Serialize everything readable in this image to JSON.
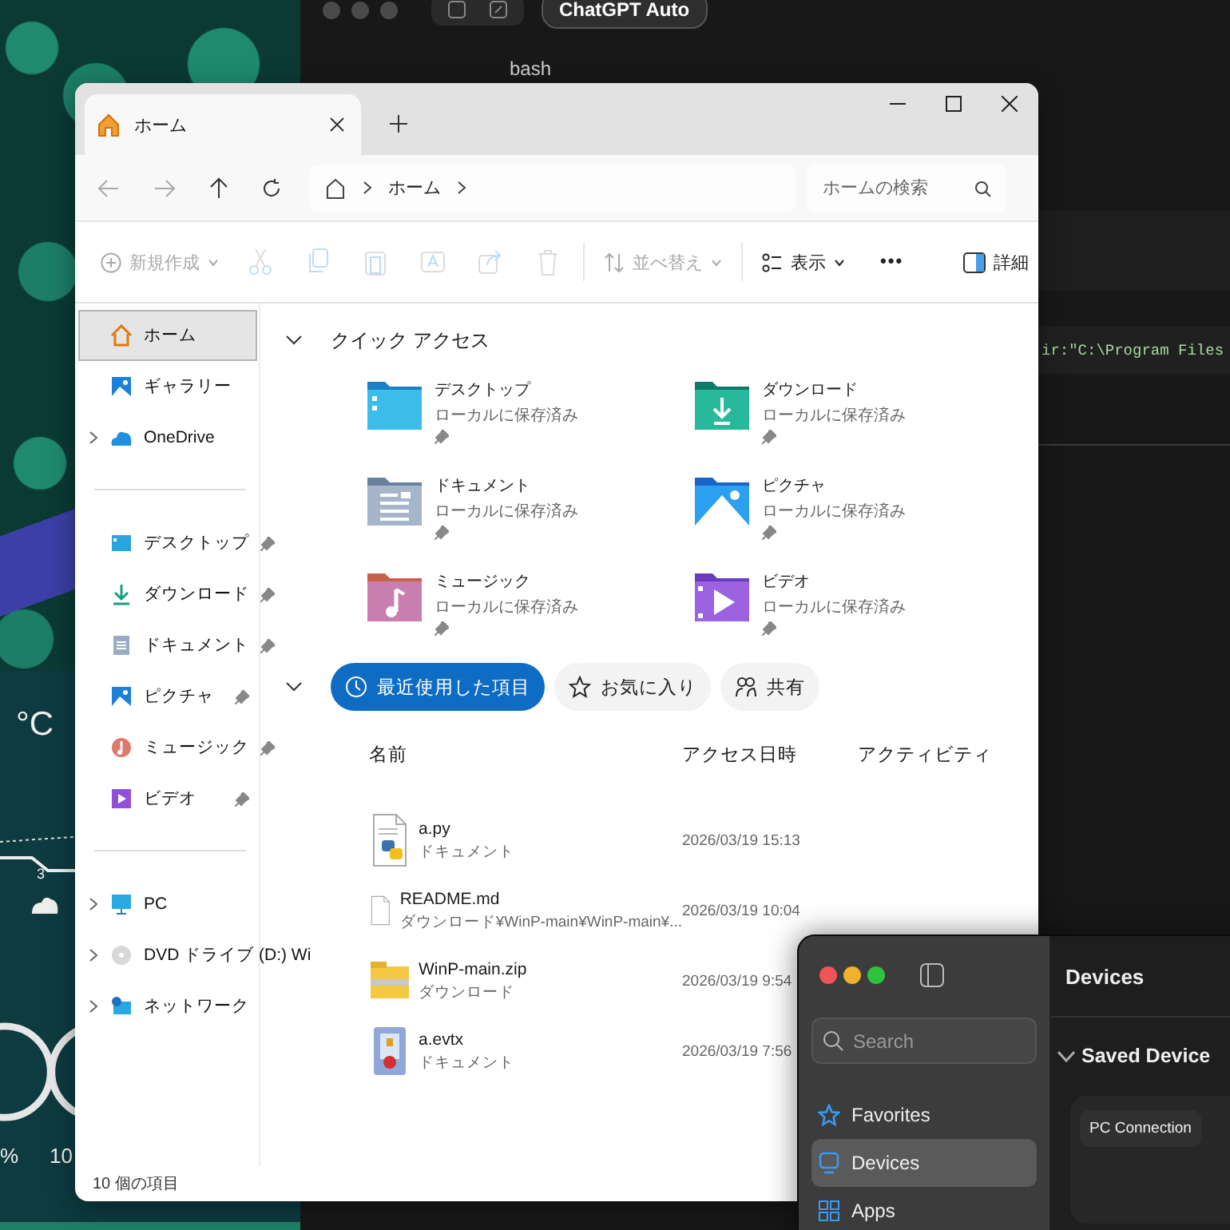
{
  "weather_widget": {
    "temperature": "°C",
    "hour_tick": "3",
    "gauges": [
      {
        "reading": "%"
      },
      {
        "reading": "10"
      }
    ]
  },
  "terminal": {
    "model_button": "ChatGPT Auto",
    "shell_label": "bash",
    "code_line": "ir:\"C:\\Program Files"
  },
  "explorer": {
    "tabs": [
      {
        "label": "ホーム",
        "selected": true
      }
    ],
    "address": {
      "segments": [
        "ホーム"
      ]
    },
    "search": {
      "placeholder": "ホームの検索"
    },
    "toolbar": [
      {
        "kind": "new",
        "label": "新規作成",
        "disabled": true
      },
      {
        "kind": "cut",
        "disabled": true
      },
      {
        "kind": "copy",
        "disabled": true
      },
      {
        "kind": "paste",
        "disabled": true
      },
      {
        "kind": "rename",
        "disabled": true
      },
      {
        "kind": "share",
        "disabled": true
      },
      {
        "kind": "delete",
        "disabled": true
      },
      {
        "kind": "sort",
        "label": "並べ替え",
        "disabled": true
      },
      {
        "kind": "view",
        "label": "表示",
        "disabled": false
      },
      {
        "kind": "more",
        "label": "•••",
        "disabled": false
      }
    ],
    "details_button": "詳細",
    "sidebar": [
      {
        "items": [
          {
            "kind": "home",
            "label": "ホーム",
            "selected": true,
            "expandable": false,
            "pinned": false
          },
          {
            "kind": "gallery",
            "label": "ギャラリー",
            "selected": false,
            "expandable": false,
            "pinned": false
          },
          {
            "kind": "cloud",
            "label": "OneDrive",
            "selected": false,
            "expandable": true,
            "pinned": false
          }
        ]
      },
      {
        "items": [
          {
            "kind": "desktop",
            "label": "デスクトップ",
            "selected": false,
            "expandable": false,
            "pinned": true
          },
          {
            "kind": "download",
            "label": "ダウンロード",
            "selected": false,
            "expandable": false,
            "pinned": true
          },
          {
            "kind": "documents",
            "label": "ドキュメント",
            "selected": false,
            "expandable": false,
            "pinned": true
          },
          {
            "kind": "pictures",
            "label": "ピクチャ",
            "selected": false,
            "expandable": false,
            "pinned": true
          },
          {
            "kind": "music",
            "label": "ミュージック",
            "selected": false,
            "expandable": false,
            "pinned": true
          },
          {
            "kind": "video",
            "label": "ビデオ",
            "selected": false,
            "expandable": false,
            "pinned": true
          }
        ]
      },
      {
        "items": [
          {
            "kind": "pc",
            "label": "PC",
            "selected": false,
            "expandable": true,
            "pinned": false
          },
          {
            "kind": "dvd",
            "label": "DVD ドライブ (D:) Wi",
            "selected": false,
            "expandable": true,
            "pinned": false
          },
          {
            "kind": "network",
            "label": "ネットワーク",
            "selected": false,
            "expandable": true,
            "pinned": false
          }
        ]
      }
    ],
    "quick_access": {
      "title": "クイック アクセス",
      "expanded": true,
      "items": [
        {
          "kind": "desktop",
          "name": "デスクトップ",
          "status": "ローカルに保存済み",
          "pinned": true
        },
        {
          "kind": "download",
          "name": "ダウンロード",
          "status": "ローカルに保存済み",
          "pinned": true
        },
        {
          "kind": "documents",
          "name": "ドキュメント",
          "status": "ローカルに保存済み",
          "pinned": true
        },
        {
          "kind": "pictures",
          "name": "ピクチャ",
          "status": "ローカルに保存済み",
          "pinned": true
        },
        {
          "kind": "music",
          "name": "ミュージック",
          "status": "ローカルに保存済み",
          "pinned": true
        },
        {
          "kind": "video",
          "name": "ビデオ",
          "status": "ローカルに保存済み",
          "pinned": true
        }
      ]
    },
    "recent": {
      "expanded": true,
      "filters": [
        {
          "kind": "recent",
          "label": "最近使用した項目",
          "selected": true
        },
        {
          "kind": "favorites",
          "label": "お気に入り",
          "selected": false
        },
        {
          "kind": "shared",
          "label": "共有",
          "selected": false
        }
      ],
      "columns": [
        "名前",
        "アクセス日時",
        "アクティビティ"
      ],
      "rows": [
        {
          "kind": "python",
          "name": "a.py",
          "location": "ドキュメント",
          "accessed": "2026/03/19 15:13"
        },
        {
          "kind": "text",
          "name": "README.md",
          "location": "ダウンロード¥WinP-main¥WinP-main¥...",
          "accessed": "2026/03/19 10:04"
        },
        {
          "kind": "zip",
          "name": "WinP-main.zip",
          "location": "ダウンロード",
          "accessed": "2026/03/19 9:54"
        },
        {
          "kind": "log",
          "name": "a.evtx",
          "location": "ドキュメント",
          "accessed": "2026/03/19 7:56"
        }
      ]
    },
    "status_bar": "10 個の項目"
  },
  "mac_window": {
    "search": {
      "placeholder": "Search"
    },
    "sidebar": [
      {
        "kind": "favorites",
        "label": "Favorites",
        "selected": false
      },
      {
        "kind": "devices",
        "label": "Devices",
        "selected": true
      },
      {
        "kind": "apps",
        "label": "Apps",
        "selected": false
      }
    ],
    "title": "Devices",
    "section": {
      "title": "Saved Device",
      "expanded": true,
      "cards": [
        {
          "label": "PC Connection"
        }
      ]
    }
  }
}
